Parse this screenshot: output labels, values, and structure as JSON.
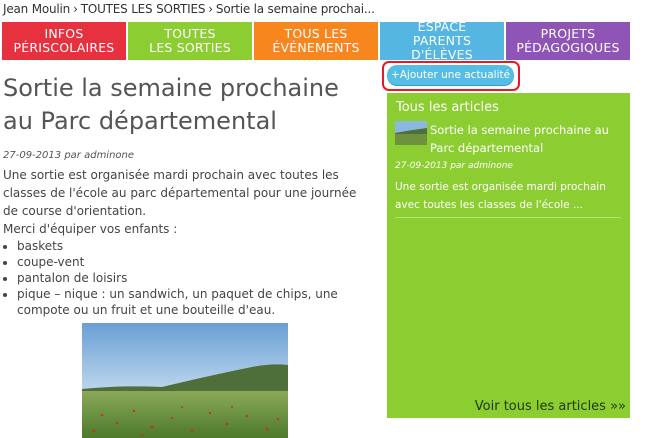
{
  "breadcrumb": {
    "items": [
      "Jean Moulin",
      "TOUTES LES SORTIES",
      "Sortie la semaine prochai..."
    ],
    "separator": "›"
  },
  "nav": {
    "items": [
      {
        "line1": "INFOS",
        "line2": "PÉRISCOLAIRES",
        "color": "#e8313f"
      },
      {
        "line1": "TOUTES",
        "line2": "LES SORTIES",
        "color": "#8ccd32"
      },
      {
        "line1": "TOUS LES",
        "line2": "ÉVÉNEMENTS",
        "color": "#f7861f"
      },
      {
        "line1": "ESPACE",
        "line2": "PARENTS D'ÉLÈVES",
        "color": "#55b6e1"
      },
      {
        "line1": "PROJETS",
        "line2": "PÉDAGOGIQUES",
        "color": "#8e55b7"
      }
    ]
  },
  "add_news_button": "+Ajouter une actualité",
  "article": {
    "title": "Sortie la semaine prochaine au Parc départemental",
    "date": "27-09-2013",
    "by_label": "par",
    "author": "adminone",
    "intro": "Une sortie est organisée mardi prochain avec toutes les classes de l'école au parc départemental pour une journée de course d'orientation.",
    "equip_intro": "Merci d'équiper vos enfants :",
    "list": [
      "baskets",
      "coupe-vent",
      "pantalon de loisirs",
      "pique – nique : un sandwich, un paquet de chips, une compote ou un fruit et une bouteille d'eau."
    ]
  },
  "sidebar": {
    "title": "Tous les articles",
    "article_title": "Sortie la semaine prochaine au Parc départemental",
    "article_date": "27-09-2013",
    "article_by": "par",
    "article_author": "adminone",
    "excerpt": "Une sortie est organisée mardi prochain avec toutes les classes de l'école ...",
    "see_all": "Voir tous les articles »»"
  },
  "colors": {
    "sidebar_bg": "#8ccd32",
    "button_bg": "#55bde6",
    "highlight_ring": "#e31b23"
  }
}
